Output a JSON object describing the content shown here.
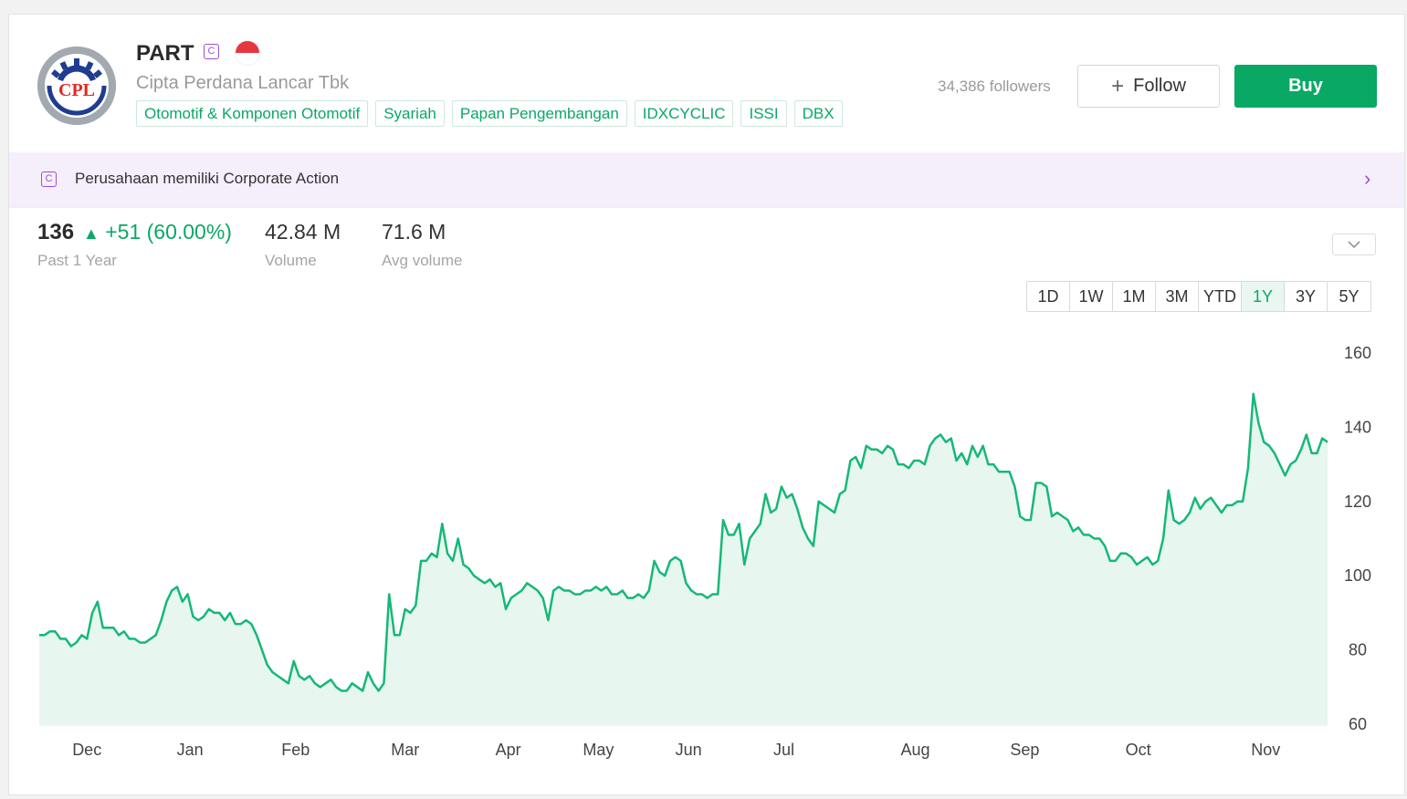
{
  "header": {
    "ticker": "PART",
    "corporate_badge": "C",
    "company_name": "Cipta Perdana Lancar Tbk",
    "logo_text": "CPL",
    "tags": [
      "Otomotif & Komponen Otomotif",
      "Syariah",
      "Papan Pengembangan",
      "IDXCYCLIC",
      "ISSI",
      "DBX"
    ],
    "followers": "34,386 followers",
    "follow_label": "Follow",
    "buy_label": "Buy"
  },
  "corporate_action": {
    "badge": "C",
    "text": "Perusahaan memiliki Corporate Action"
  },
  "stats": {
    "price": "136",
    "change": "+51 (60.00%)",
    "period_label": "Past 1 Year",
    "volume": "42.84 M",
    "volume_label": "Volume",
    "avg_volume": "71.6 M",
    "avg_volume_label": "Avg volume"
  },
  "ranges": [
    "1D",
    "1W",
    "1M",
    "3M",
    "YTD",
    "1Y",
    "3Y",
    "5Y"
  ],
  "active_range": "1Y",
  "colors": {
    "accent": "#0aa865",
    "line": "#16b877",
    "fill": "#e7f6ef",
    "corporate": "#9b4fd6"
  },
  "chart_data": {
    "type": "area",
    "title": "",
    "xlabel": "",
    "ylabel": "",
    "x_ticks": [
      "Dec",
      "Jan",
      "Feb",
      "Mar",
      "Apr",
      "May",
      "Jun",
      "Jul",
      "Aug",
      "Sep",
      "Oct",
      "Nov"
    ],
    "y_ticks": [
      60,
      80,
      100,
      120,
      140,
      160
    ],
    "ylim": [
      60,
      160
    ],
    "grid": false,
    "axis_side": "right",
    "values": [
      84,
      84,
      85,
      85,
      83,
      83,
      81,
      82,
      84,
      83,
      90,
      93,
      86,
      86,
      86,
      84,
      85,
      83,
      83,
      82,
      82,
      83,
      84,
      88,
      93,
      96,
      97,
      93,
      95,
      89,
      88,
      89,
      91,
      90,
      90,
      88,
      90,
      87,
      87,
      88,
      87,
      84,
      80,
      76,
      74,
      73,
      72,
      71,
      77,
      73,
      72,
      73,
      71,
      70,
      71,
      72,
      70,
      69,
      69,
      71,
      70,
      69,
      74,
      71,
      69,
      71,
      95,
      84,
      84,
      91,
      90,
      92,
      104,
      104,
      106,
      105,
      114,
      106,
      104,
      110,
      103,
      102,
      100,
      99,
      98,
      99,
      97,
      98,
      91,
      94,
      95,
      96,
      98,
      97,
      96,
      94,
      88,
      96,
      97,
      96,
      96,
      95,
      95,
      96,
      96,
      97,
      96,
      97,
      95,
      95,
      96,
      94,
      94,
      95,
      94,
      96,
      104,
      101,
      100,
      104,
      105,
      104,
      98,
      96,
      95,
      95,
      94,
      95,
      95,
      115,
      111,
      111,
      114,
      103,
      110,
      112,
      114,
      122,
      117,
      118,
      124,
      121,
      122,
      118,
      113,
      110,
      108,
      120,
      119,
      118,
      117,
      122,
      123,
      131,
      132,
      129,
      135,
      134,
      134,
      133,
      135,
      134,
      130,
      130,
      129,
      131,
      131,
      130,
      135,
      137,
      138,
      136,
      137,
      131,
      133,
      130,
      135,
      132,
      135,
      130,
      130,
      128,
      128,
      128,
      124,
      116,
      115,
      115,
      125,
      125,
      124,
      116,
      117,
      116,
      115,
      112,
      113,
      111,
      111,
      110,
      110,
      108,
      104,
      104,
      106,
      106,
      105,
      103,
      104,
      105,
      103,
      104,
      110,
      123,
      115,
      114,
      115,
      117,
      121,
      118,
      120,
      121,
      119,
      117,
      119,
      119,
      120,
      120,
      129,
      149,
      141,
      136,
      135,
      133,
      130,
      127,
      130,
      131,
      134,
      138,
      133,
      133,
      137,
      136
    ]
  }
}
